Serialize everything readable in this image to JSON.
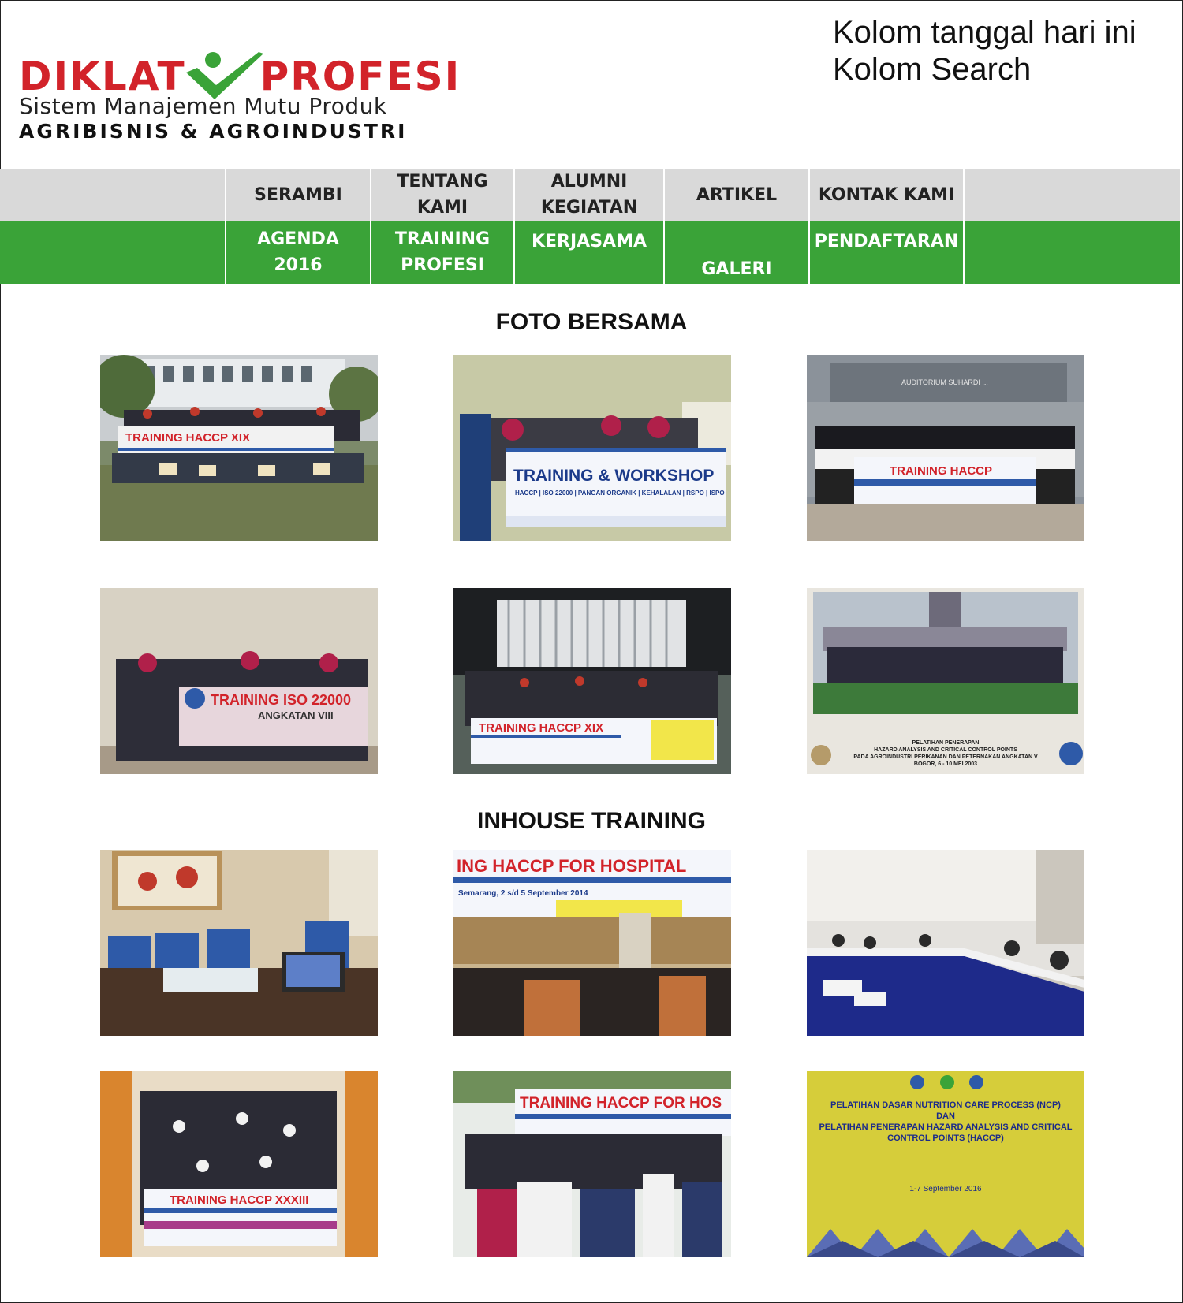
{
  "header": {
    "logo_word_left": "DIKLAT",
    "logo_word_right": "PROFESI",
    "logo_tagline": "Sistem Manajemen Mutu Produk",
    "logo_subtitle": "AGRIBISNIS & AGROINDUSTRI",
    "top_note_line1": "Kolom tanggal hari ini",
    "top_note_line2": "Kolom Search"
  },
  "colors": {
    "brand_red": "#d2232a",
    "brand_green": "#3aa338",
    "nav_gray": "#d9d9d9"
  },
  "nav": {
    "row1": [
      "SERAMBI",
      "TENTANG\nKAMI",
      "ALUMNI\nKEGIATAN",
      "ARTIKEL",
      "KONTAK KAMI"
    ],
    "row2": [
      "AGENDA\n2016",
      "TRAINING\nPROFESI",
      "KERJASAMA",
      "GALERI",
      "PENDAFTARAN"
    ]
  },
  "sections": {
    "foto_bersama_title": "FOTO BERSAMA",
    "inhouse_title": "INHOUSE TRAINING"
  },
  "photos": {
    "p1": {
      "banner": "TRAINING HACCP XIX"
    },
    "p2": {
      "banner": "TRAINING & WORKSHOP",
      "sub": "HACCP | ISO 22000 | PANGAN ORGANIK | KEHALALAN | RSPO | ISPO"
    },
    "p3": {
      "banner": "TRAINING HACCP",
      "top": "AUDITORIUM SUHARDI ..."
    },
    "p4": {
      "banner": "TRAINING ISO 22000",
      "sub": "ANGKATAN VIII"
    },
    "p5": {
      "banner": "TRAINING HACCP XIX"
    },
    "p6": {
      "caption1": "PELATIHAN PENERAPAN",
      "caption2": "HAZARD ANALYSIS AND CRITICAL CONTROL POINTS",
      "caption3": "PADA AGROINDUSTRI PERIKANAN DAN PETERNAKAN ANGKATAN V",
      "caption4": "BOGOR, 6 - 10 MEI 2003"
    },
    "p8": {
      "banner": "ING HACCP FOR HOSPITAL",
      "sub": "Semarang, 2 s/d 5 September 2014"
    },
    "p10": {
      "banner": "TRAINING HACCP XXXIII"
    },
    "p11": {
      "banner": "TRAINING HACCP FOR HOS"
    },
    "p12": {
      "line1": "PELATIHAN DASAR NUTRITION CARE PROCESS (NCP)",
      "line2": "DAN",
      "line3": "PELATIHAN PENERAPAN HAZARD ANALYSIS AND CRITICAL",
      "line4": "CONTROL POINTS (HACCP)",
      "line5": "1-7 September 2016"
    }
  }
}
